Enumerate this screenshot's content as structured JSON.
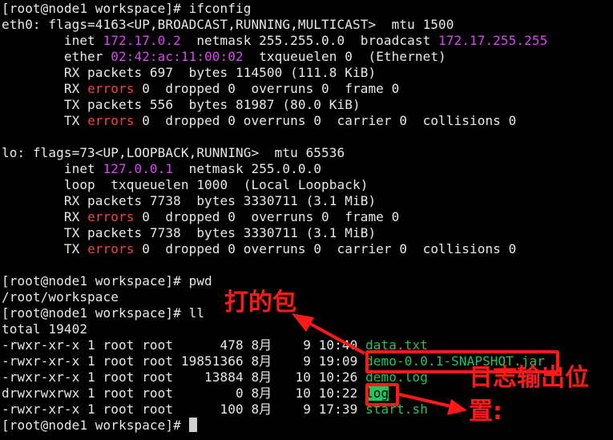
{
  "terminal": {
    "lines": [
      [
        {
          "t": "[root@node1 workspace]# ifconfig"
        }
      ],
      [
        {
          "t": "eth0: flags=4163<UP,BROADCAST,RUNNING,MULTICAST>  mtu 1500"
        }
      ],
      [
        {
          "t": "        inet "
        },
        {
          "t": "172.17.0.2",
          "c": "mag"
        },
        {
          "t": "  netmask 255.255.0.0  broadcast "
        },
        {
          "t": "172.17.255.255",
          "c": "mag"
        }
      ],
      [
        {
          "t": "        ether "
        },
        {
          "t": "02:42:ac:11:00:02",
          "c": "mag"
        },
        {
          "t": "  txqueuelen 0  (Ethernet)"
        }
      ],
      [
        {
          "t": "        RX packets 697  bytes 114500 (111.8 KiB)"
        }
      ],
      [
        {
          "t": "        RX "
        },
        {
          "t": "errors",
          "c": "red"
        },
        {
          "t": " 0  dropped 0  overruns 0  frame 0"
        }
      ],
      [
        {
          "t": "        TX packets 556  bytes 81987 (80.0 KiB)"
        }
      ],
      [
        {
          "t": "        TX "
        },
        {
          "t": "errors",
          "c": "red"
        },
        {
          "t": " 0  dropped 0 overruns 0  carrier 0  collisions 0"
        }
      ],
      [
        {
          "t": ""
        }
      ],
      [
        {
          "t": "lo: flags=73<UP,LOOPBACK,RUNNING>  mtu 65536"
        }
      ],
      [
        {
          "t": "        inet "
        },
        {
          "t": "127.0.0.1",
          "c": "mag"
        },
        {
          "t": "  netmask 255.0.0.0"
        }
      ],
      [
        {
          "t": "        loop  txqueuelen 1000  (Local Loopback)"
        }
      ],
      [
        {
          "t": "        RX packets 7738  bytes 3330711 (3.1 MiB)"
        }
      ],
      [
        {
          "t": "        RX "
        },
        {
          "t": "errors",
          "c": "red"
        },
        {
          "t": " 0  dropped 0  overruns 0  frame 0"
        }
      ],
      [
        {
          "t": "        TX packets 7738  bytes 3330711 (3.1 MiB)"
        }
      ],
      [
        {
          "t": "        TX "
        },
        {
          "t": "errors",
          "c": "red"
        },
        {
          "t": " 0  dropped 0 overruns 0  carrier 0  collisions 0"
        }
      ],
      [
        {
          "t": ""
        }
      ],
      [
        {
          "t": "[root@node1 workspace]# pwd"
        }
      ],
      [
        {
          "t": "/root/workspace"
        }
      ],
      [
        {
          "t": "[root@node1 workspace]# ll"
        }
      ],
      [
        {
          "t": "total 19402"
        }
      ],
      [
        {
          "t": "-rwxr-xr-x 1 root root      478 8月    9 10:40 "
        },
        {
          "t": "data.txt",
          "c": "grn"
        }
      ],
      [
        {
          "t": "-rwxr-xr-x 1 root root 19851366 8月    9 19:09 "
        },
        {
          "t": "demo-0.0.1-SNAPSHOT.jar",
          "c": "grn"
        }
      ],
      [
        {
          "t": "-rwxr-xr-x 1 root root    13884 8月   10 10:26 "
        },
        {
          "t": "demo.log",
          "c": "grn"
        }
      ],
      [
        {
          "t": "drwxrwxrwx 1 root root        0 8月   10 10:22 "
        },
        {
          "t": "log",
          "c": "hl"
        }
      ],
      [
        {
          "t": "-rwxr-xr-x 1 root root      100 8月    9 17:39 "
        },
        {
          "t": "start.sh",
          "c": "grn"
        }
      ],
      [
        {
          "t": "[root@node1 workspace]# "
        }
      ]
    ]
  },
  "annotations": {
    "package_note": "打的包",
    "log_note_line1": "日志输出位",
    "log_note_line2": "置:"
  },
  "colors": {
    "background": "#000000",
    "text": "#e8e8e8",
    "ip": "#d946ef",
    "error": "#ef4444",
    "file": "#22c55e",
    "annotation": "#ff1a1a"
  }
}
